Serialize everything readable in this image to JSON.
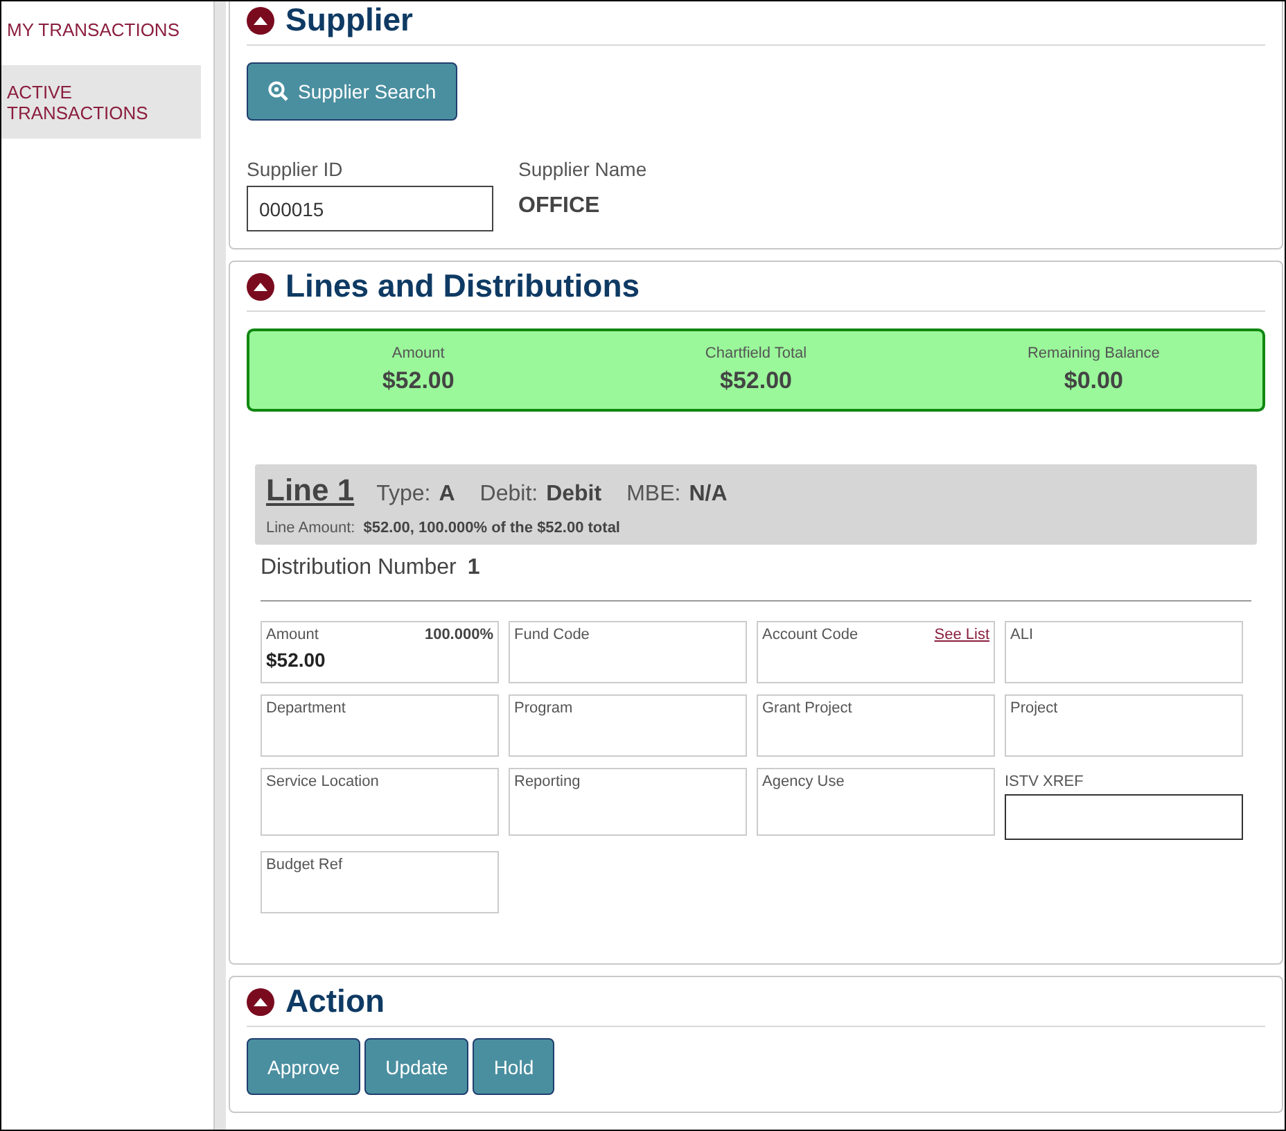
{
  "sidebar": {
    "items": [
      {
        "label": "MY TRANSACTIONS",
        "selected": false
      },
      {
        "label": "ACTIVE TRANSACTIONS",
        "selected": true
      }
    ]
  },
  "supplier": {
    "title": "Supplier",
    "expanded": true,
    "search_button": "Supplier Search",
    "supplier_id": {
      "label": "Supplier ID",
      "value": "000015"
    },
    "supplier_name": {
      "label": "Supplier Name",
      "value": "OFFICE"
    }
  },
  "lines": {
    "title": "Lines and Distributions",
    "expanded": true,
    "summary": [
      {
        "label": "Amount",
        "value": "$52.00"
      },
      {
        "label": "Chartfield Total",
        "value": "$52.00"
      },
      {
        "label": "Remaining Balance",
        "value": "$0.00"
      }
    ],
    "line": {
      "title": "Line 1",
      "type_label": "Type:",
      "type": "A",
      "debit_label": "Debit:",
      "debit": "Debit",
      "mbe_label": "MBE:",
      "mbe": "N/A",
      "amount_label": "Line Amount:",
      "amount_text": "$52.00, 100.000% of the $52.00 total"
    },
    "distribution": {
      "label": "Distribution Number",
      "number": "1",
      "fields": [
        {
          "kind": "box",
          "label": "Amount",
          "percent": "100.000%",
          "value": "$52.00"
        },
        {
          "kind": "box",
          "label": "Fund Code"
        },
        {
          "kind": "box",
          "label": "Account Code",
          "link": "See List"
        },
        {
          "kind": "box",
          "label": "ALI"
        },
        {
          "kind": "box",
          "label": "Department"
        },
        {
          "kind": "box",
          "label": "Program"
        },
        {
          "kind": "box",
          "label": "Grant Project"
        },
        {
          "kind": "box",
          "label": "Project"
        },
        {
          "kind": "box",
          "label": "Service Location"
        },
        {
          "kind": "box",
          "label": "Reporting"
        },
        {
          "kind": "box",
          "label": "Agency Use"
        },
        {
          "kind": "input",
          "label": "ISTV XREF"
        },
        {
          "kind": "box",
          "label": "Budget Ref"
        }
      ]
    }
  },
  "action": {
    "title": "Action",
    "expanded": true,
    "buttons": [
      "Approve",
      "Update",
      "Hold"
    ]
  }
}
